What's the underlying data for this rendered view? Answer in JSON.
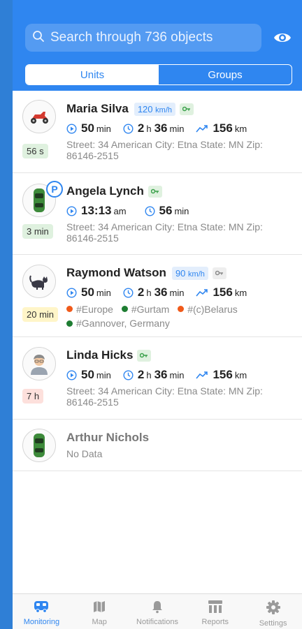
{
  "colors": {
    "accent": "#2f86f0",
    "muted": "#8a8a8a",
    "green_tag": "#1e7d32",
    "orange_tag": "#f05a1a"
  },
  "search": {
    "placeholder": "Search through 736 objects",
    "icon": "search-icon"
  },
  "segment": {
    "units": "Units",
    "groups": "Groups",
    "selected": "Units"
  },
  "units": [
    {
      "name": "Maria Silva",
      "speed": {
        "value": "120",
        "unit": "km/h"
      },
      "key": "green",
      "badge": "56 s",
      "icon": "scooter-icon",
      "stats": {
        "a": "50",
        "a_unit": "min",
        "b_h": "2",
        "b_h_unit": "h",
        "b_m": "36",
        "b_m_unit": "min",
        "dist": "156",
        "dist_unit": "km"
      },
      "address": "Street: 34 American City: Etna State: MN Zip: 86146-2515"
    },
    {
      "name": "Angela Lynch",
      "key": "green",
      "badge": "3 min",
      "icon": "car-icon",
      "parking": "P",
      "stats": {
        "time": "13:13",
        "time_unit": "am",
        "dur": "56",
        "dur_unit": "min"
      },
      "address": "Street: 34 American City: Etna State: MN Zip: 86146-2515"
    },
    {
      "name": "Raymond Watson",
      "speed": {
        "value": "90",
        "unit": "km/h"
      },
      "key": "grey",
      "badge": "20 min",
      "icon": "cat-icon",
      "stats": {
        "a": "50",
        "a_unit": "min",
        "b_h": "2",
        "b_h_unit": "h",
        "b_m": "36",
        "b_m_unit": "min",
        "dist": "156",
        "dist_unit": "km"
      },
      "tags": [
        "#Europe",
        "#Gurtam",
        "#(c)Belarus",
        "#Gannover, Germany"
      ]
    },
    {
      "name": "Linda Hicks",
      "key": "green",
      "badge": "7 h",
      "icon": "person-icon",
      "stats": {
        "a": "50",
        "a_unit": "min",
        "b_h": "2",
        "b_h_unit": "h",
        "b_m": "36",
        "b_m_unit": "min",
        "dist": "156",
        "dist_unit": "km"
      },
      "address": "Street: 34 American City: Etna State: MN Zip: 86146-2515"
    },
    {
      "name": "Arthur Nichols",
      "icon": "car-icon",
      "status": "No Data"
    }
  ],
  "tabs": [
    {
      "label": "Monitoring",
      "icon": "bus-icon",
      "active": true
    },
    {
      "label": "Map",
      "icon": "map-icon",
      "active": false
    },
    {
      "label": "Notifications",
      "icon": "bell-icon",
      "active": false
    },
    {
      "label": "Reports",
      "icon": "reports-icon",
      "active": false
    },
    {
      "label": "Settings",
      "icon": "gear-icon",
      "active": false
    }
  ]
}
